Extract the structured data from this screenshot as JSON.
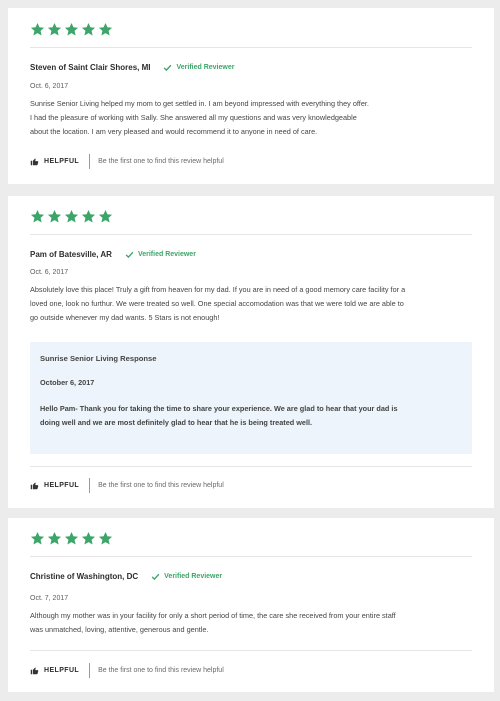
{
  "reviews": [
    {
      "rating": 5,
      "author": "Steven of Saint Clair Shores, MI",
      "verified_label": "Verified Reviewer",
      "date": "Oct. 6, 2017",
      "lines": [
        "Sunrise Senior Living helped my mom to get settled in.  I am beyond impressed with everything they offer.",
        "I had the pleasure of working with Sally. She answered all my questions and was very knowledgeable",
        "about the location. I am very pleased and would recommend it to anyone in need of care."
      ],
      "helpful_label": "HELPFUL",
      "helpful_prompt": "Be the first one to find this review helpful"
    },
    {
      "rating": 5,
      "author": "Pam of Batesville, AR",
      "verified_label": "Verified Reviewer",
      "date": "Oct. 6, 2017",
      "lines": [
        "Absolutely love this place!  Truly a gift from heaven for my dad. If you are in need of a good memory care facility for a",
        "loved one, look no furthur. We were treated so well.  One special accomodation was that we were told we are able to",
        "go outside whenever my dad wants.  5 Stars is not enough!"
      ],
      "response": {
        "title": "Sunrise Senior Living Response",
        "date": "October 6, 2017",
        "lines": [
          "Hello Pam- Thank you for taking the time to share your experience. We are glad to hear that your dad is",
          "doing well and we are most definitely glad to hear that he is being treated well."
        ]
      },
      "helpful_label": "HELPFUL",
      "helpful_prompt": "Be the first one to find this review helpful"
    },
    {
      "rating": 5,
      "author": "Christine of Washington, DC",
      "verified_label": "Verified Reviewer",
      "date": "Oct. 7, 2017",
      "lines": [
        "Although my mother was in your facility for only a short period of time, the care she received from your entire staff",
        "was unmatched, loving, attentive, generous and gentle."
      ],
      "helpful_label": "HELPFUL",
      "helpful_prompt": "Be the first one to find this review helpful"
    }
  ],
  "icons": {
    "star": "star-icon",
    "verified": "checkmark-icon",
    "helpful": "thumbs-up-icon"
  },
  "colors": {
    "accent_green": "#3ea56a",
    "response_bg": "#edf4fb",
    "page_bg": "#ececec"
  }
}
